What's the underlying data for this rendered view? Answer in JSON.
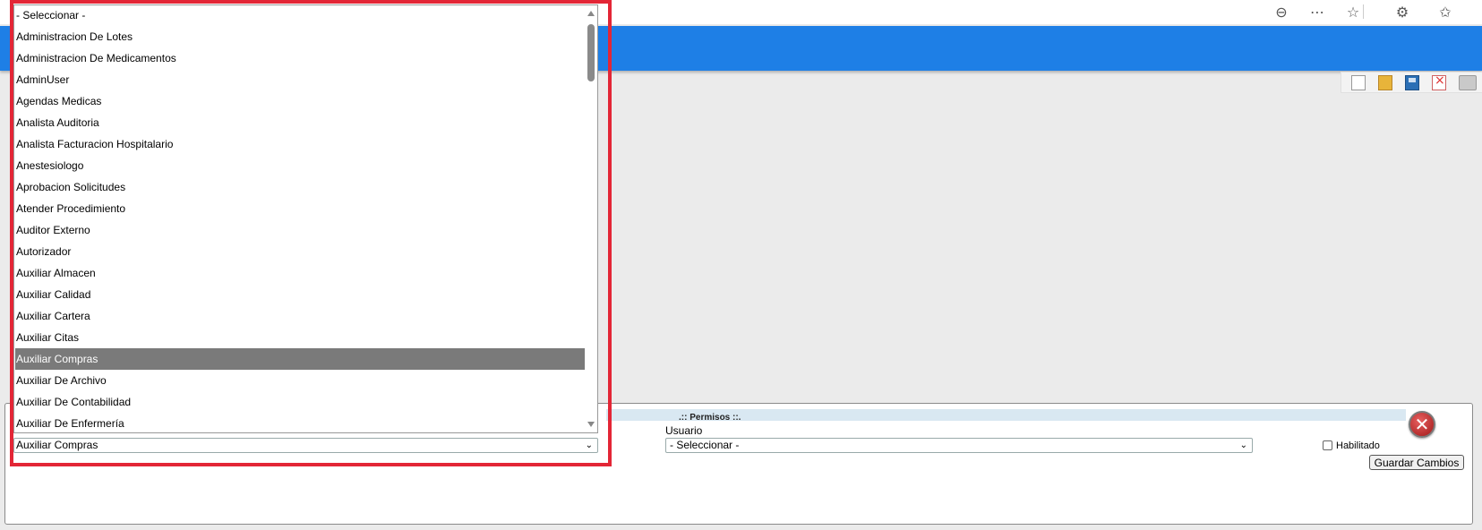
{
  "browser": {
    "icons": [
      "zoom-out-icon",
      "more-icon",
      "favorite-star-icon",
      "extensions-icon",
      "favorites-list-icon"
    ]
  },
  "toolbar": {
    "actions": [
      "new-document-icon",
      "open-folder-icon",
      "save-icon",
      "delete-icon",
      "print-icon"
    ]
  },
  "permisos": {
    "title": ".:: Permisos ::.",
    "perfil_value": "Auxiliar Compras",
    "usuario_label": "Usuario",
    "usuario_value": "- Seleccionar -",
    "habilitado_label": "Habilitado",
    "habilitado_checked": false,
    "save_label": "Guardar Cambios"
  },
  "dropdown": {
    "options": [
      "- Seleccionar -",
      "Administracion De Lotes",
      "Administracion De Medicamentos",
      "AdminUser",
      "Agendas Medicas",
      "Analista Auditoria",
      "Analista Facturacion Hospitalario",
      "Anestesiologo",
      "Aprobacion Solicitudes",
      "Atender Procedimiento",
      "Auditor Externo",
      "Autorizador",
      "Auxiliar Almacen",
      "Auxiliar Calidad",
      "Auxiliar Cartera",
      "Auxiliar Citas",
      "Auxiliar Compras",
      "Auxiliar De Archivo",
      "Auxiliar De Contabilidad",
      "Auxiliar De Enfermería"
    ],
    "selected_index": 16
  },
  "colors": {
    "header_blue": "#1e7fe6",
    "selected_option_bg": "#7a7a7a",
    "highlight_red": "#e32636",
    "panel_title_bg": "#d9e8f2"
  }
}
